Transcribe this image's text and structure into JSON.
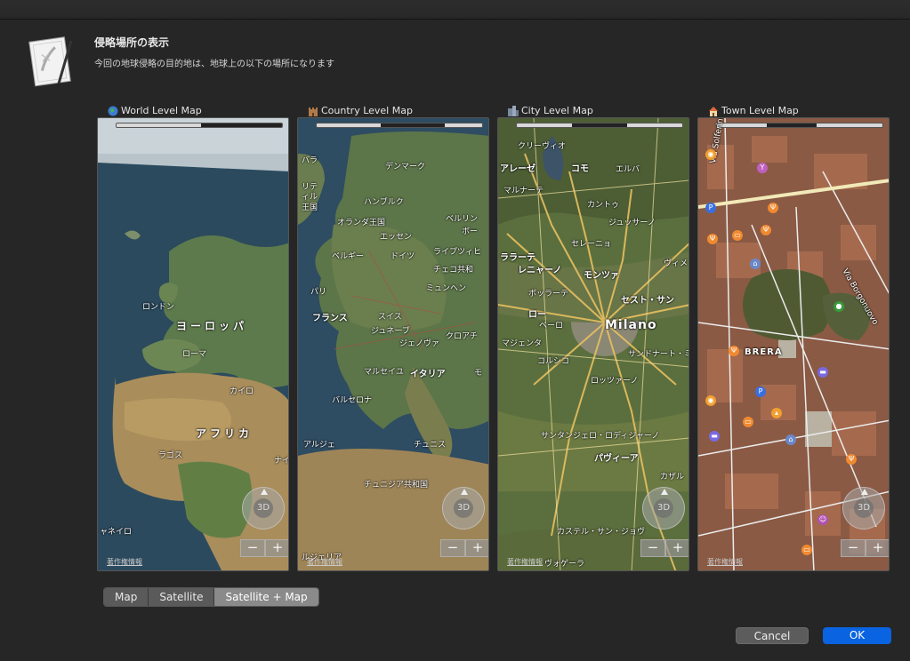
{
  "dialog": {
    "title": "侵略場所の表示",
    "subtitle": "今回の地球侵略の目的地は、地球上の以下の場所になります"
  },
  "panels": [
    {
      "label": "World Level Map",
      "icon": "globe-icon",
      "scale_fill": 0.47,
      "labels": [
        "ロンドン",
        "ヨーロッパ",
        "ローマ",
        "カイロ",
        "アフリカ",
        "ラゴス",
        "ナイ",
        "ャネイロ"
      ]
    },
    {
      "label": "Country Level Map",
      "icon": "castle-icon",
      "scale_fill": 0.38,
      "labels": [
        "バラ",
        "デンマーク",
        "リテ",
        "ィル",
        "王国",
        "ハンブルク",
        "オランダ王国",
        "ベルリン",
        "エッセン",
        "ボー",
        "ライプツィヒ",
        "ベルギー",
        "ドイツ",
        "チェコ共和",
        "パリ",
        "ミュンヘン",
        "フランス",
        "スイス",
        "ジュネーブ",
        "ジェノヴァ",
        "クロアチ",
        "マルセイユ",
        "イタリア",
        "モ",
        "バルセロナ",
        "アルジェ",
        "チュニス",
        "チュニジア共和国",
        "ルジェリア"
      ]
    },
    {
      "label": "City Level Map",
      "icon": "city-icon",
      "scale_fill": 0.33,
      "labels": [
        "クリーヴィオ",
        "アレーゼ",
        "コモ",
        "エルバ",
        "マルナーテ",
        "カントゥ",
        "ジュッサーノ",
        "セレーニョ",
        "ララーテ",
        "レニャーノ",
        "モンツァ",
        "ヴィメ",
        "ボッラーテ",
        "セスト・サン",
        "ロー",
        "ベーロ",
        "Milano",
        "マジェンタ",
        "サンドナート・ミ",
        "コルシコ",
        "ロッツァーノ",
        "サンタンジェロ・ロディジャーノ",
        "パヴィーア",
        "カザル",
        "カステル・サン・ジョヴ",
        "ヴォゲーラ"
      ]
    },
    {
      "label": "Town Level Map",
      "icon": "house-icon",
      "scale_fill": 0.3,
      "labels": [
        "Via Solferino",
        "Via Borgonuovo",
        "BRERA"
      ]
    }
  ],
  "map_controls": {
    "compass_label": "3D",
    "zoom_out": "−",
    "zoom_in": "+",
    "copyright": "著作権情報"
  },
  "map_type": {
    "options": [
      "Map",
      "Satellite",
      "Satellite + Map"
    ],
    "selected": "Satellite + Map"
  },
  "buttons": {
    "cancel": "Cancel",
    "ok": "OK"
  },
  "colors": {
    "accent": "#0a63e0",
    "window_bg": "#262626"
  }
}
